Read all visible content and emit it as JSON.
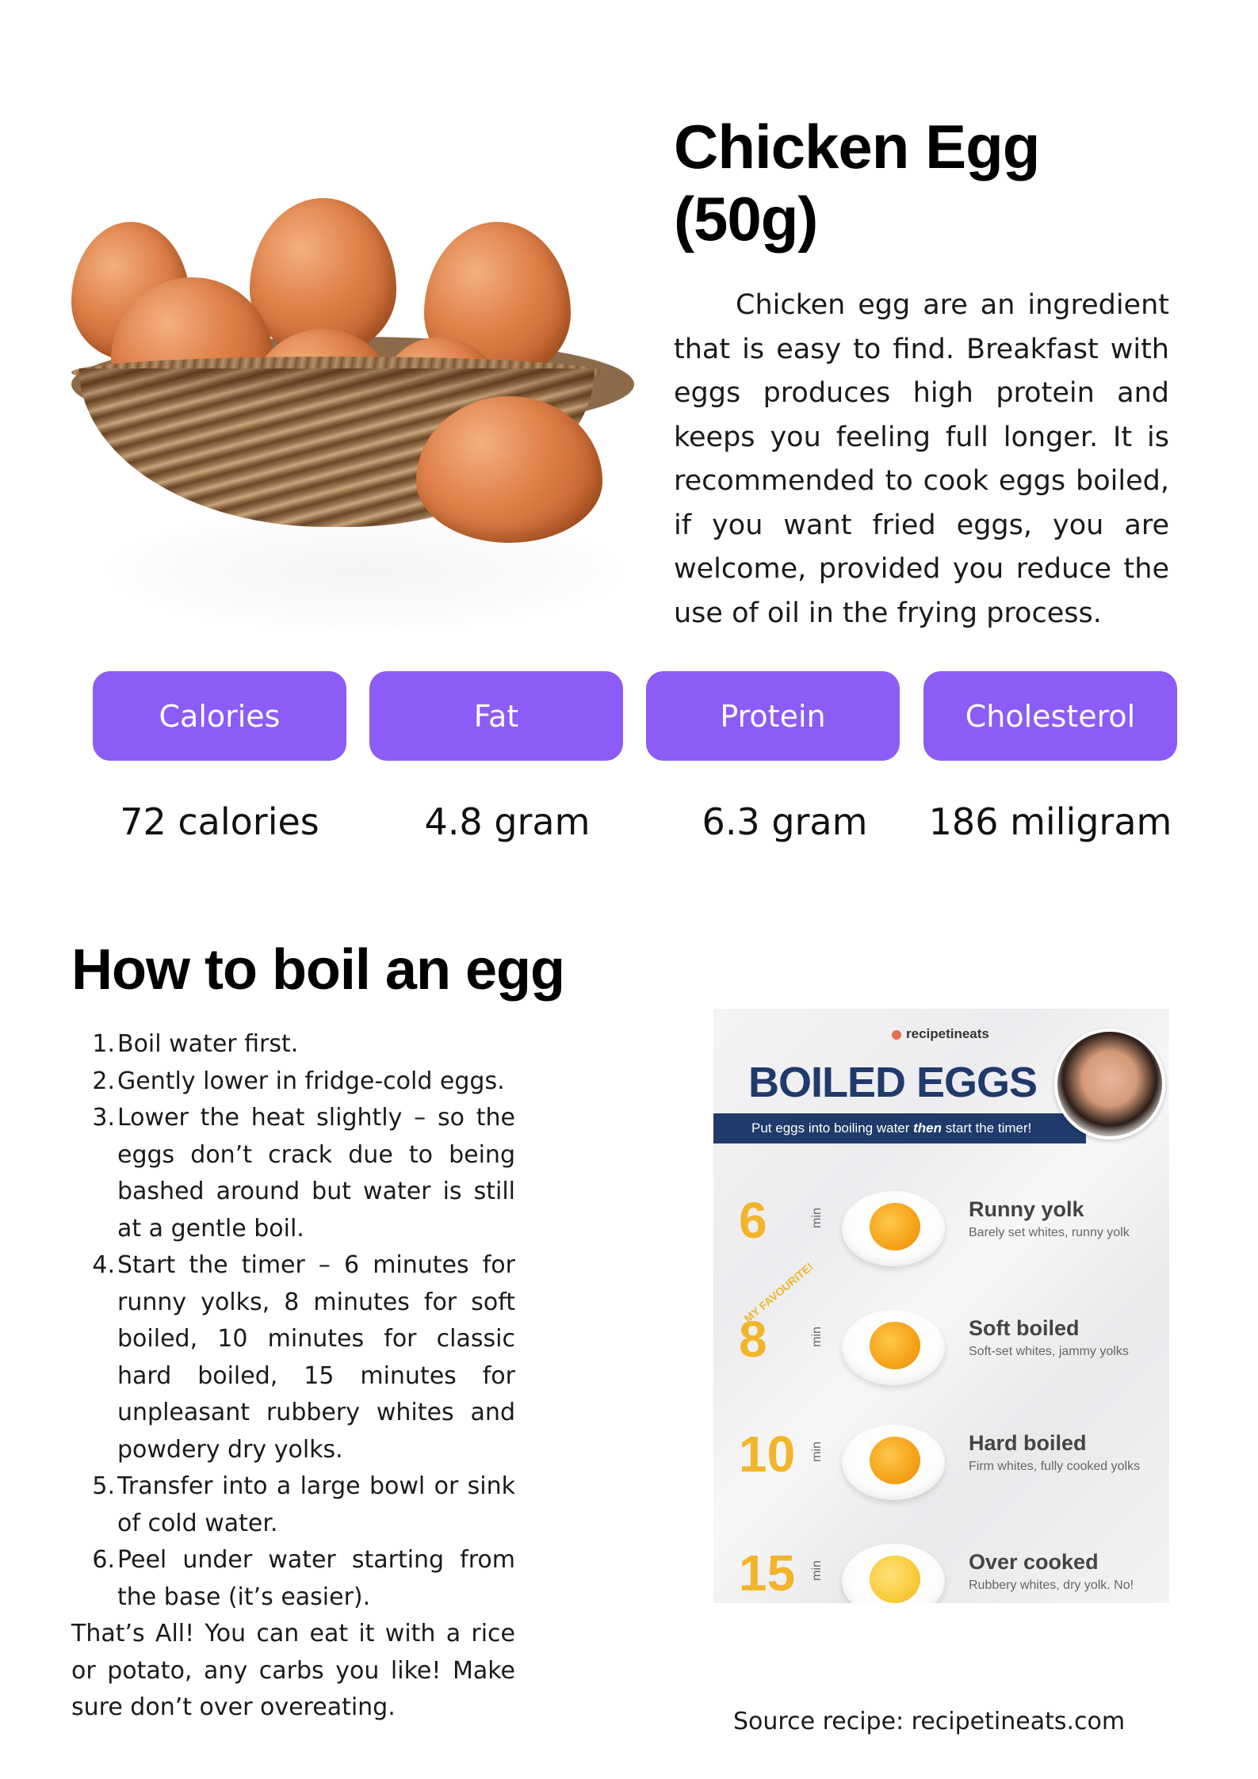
{
  "header": {
    "title": "Chicken Egg (50g)"
  },
  "description": "Chicken egg are an ingredient that is easy to find. Breakfast with eggs produces high protein and keeps you feeling full longer. It is recommended to cook eggs boiled, if you want fried eggs, you are welcome, provided you reduce the use of oil in the frying process.",
  "nutrition": [
    {
      "label": "Calories",
      "value": "72 calories"
    },
    {
      "label": "Fat",
      "value": "4.8 gram"
    },
    {
      "label": "Protein",
      "value": "6.3 gram"
    },
    {
      "label": "Cholesterol",
      "value": "186 miligram"
    }
  ],
  "howto": {
    "heading": "How to boil an egg",
    "steps": [
      {
        "num": "1.",
        "text": "Boil water first."
      },
      {
        "num": "2.",
        "text": "Gently lower in fridge-cold eggs."
      },
      {
        "num": "3.",
        "text": "Lower the heat slightly – so the eggs don’t crack due to being bashed around but water is still at a gentle boil."
      },
      {
        "num": "4.",
        "text": "Start the timer – 6 minutes for runny yolks, 8 minutes for soft boiled, 10 minutes for classic hard boiled, 15 minutes for unpleasant rubbery whites and powdery dry yolks."
      },
      {
        "num": "5.",
        "text": "Transfer into a large bowl or sink of cold water."
      },
      {
        "num": "6.",
        "text": "Peel under water starting from the base (it’s easier)."
      }
    ],
    "outro": "That’s All! You can eat it with a rice or potato, any carbs you like! Make sure don’t over overeating."
  },
  "infographic": {
    "brand": "recipetineats",
    "title": "BOILED EGGS",
    "banner_pre": "Put eggs into boiling water ",
    "banner_em": "then",
    "banner_post": " start the timer!",
    "min_label": "min",
    "favourite": "MY FAVOURITE!",
    "rows": [
      {
        "minutes": "6",
        "name": "Runny yolk",
        "sub": "Barely set whites, runny yolk"
      },
      {
        "minutes": "8",
        "name": "Soft boiled",
        "sub": "Soft-set whites, jammy yolks"
      },
      {
        "minutes": "10",
        "name": "Hard boiled",
        "sub": "Firm whites, fully cooked yolks"
      },
      {
        "minutes": "15",
        "name": "Over cooked",
        "sub": "Rubbery whites, dry yolk. No!"
      }
    ]
  },
  "source": "Source recipe: recipetineats.com",
  "colors": {
    "accent": "#8b5cf6",
    "navy": "#1f3a6b",
    "yolk_number": "#f2b42a"
  }
}
